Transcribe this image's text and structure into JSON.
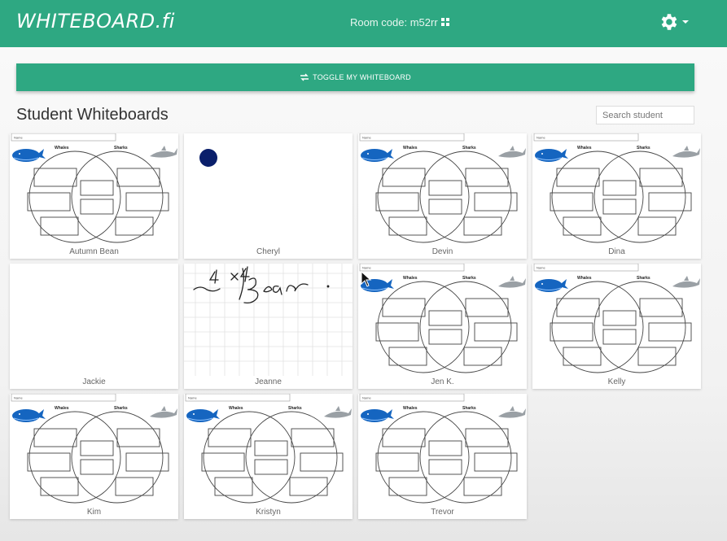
{
  "header": {
    "logo": "WHITEBOARD.fi",
    "room_code": "Room code: m52rr",
    "qr_icon": "qr-code-icon",
    "settings_icon": "gear-icon"
  },
  "toolbar": {
    "toggle_label": "TOGGLE MY WHITEBOARD",
    "toggle_icon": "swap-icon"
  },
  "main": {
    "title": "Student Whiteboards"
  },
  "search": {
    "placeholder": "Search student"
  },
  "venn": {
    "name_label": "Name",
    "left_label": "Whales",
    "right_label": "Sharks"
  },
  "colors": {
    "brand": "#2ea882",
    "whale": "#1565c0",
    "dot": "#0a1f6b"
  },
  "students": [
    {
      "name": "Autumn Bean",
      "board": "venn"
    },
    {
      "name": "Cheryl",
      "board": "dot"
    },
    {
      "name": "Devin",
      "board": "venn"
    },
    {
      "name": "Dina",
      "board": "venn"
    },
    {
      "name": "Jackie",
      "board": "blank"
    },
    {
      "name": "Jeanne",
      "board": "grid-writing",
      "writing": "4 x 4 ~ Bean"
    },
    {
      "name": "Jen K.",
      "board": "venn"
    },
    {
      "name": "Kelly",
      "board": "venn"
    },
    {
      "name": "Kim",
      "board": "venn"
    },
    {
      "name": "Kristyn",
      "board": "venn"
    },
    {
      "name": "Trevor",
      "board": "venn"
    }
  ]
}
